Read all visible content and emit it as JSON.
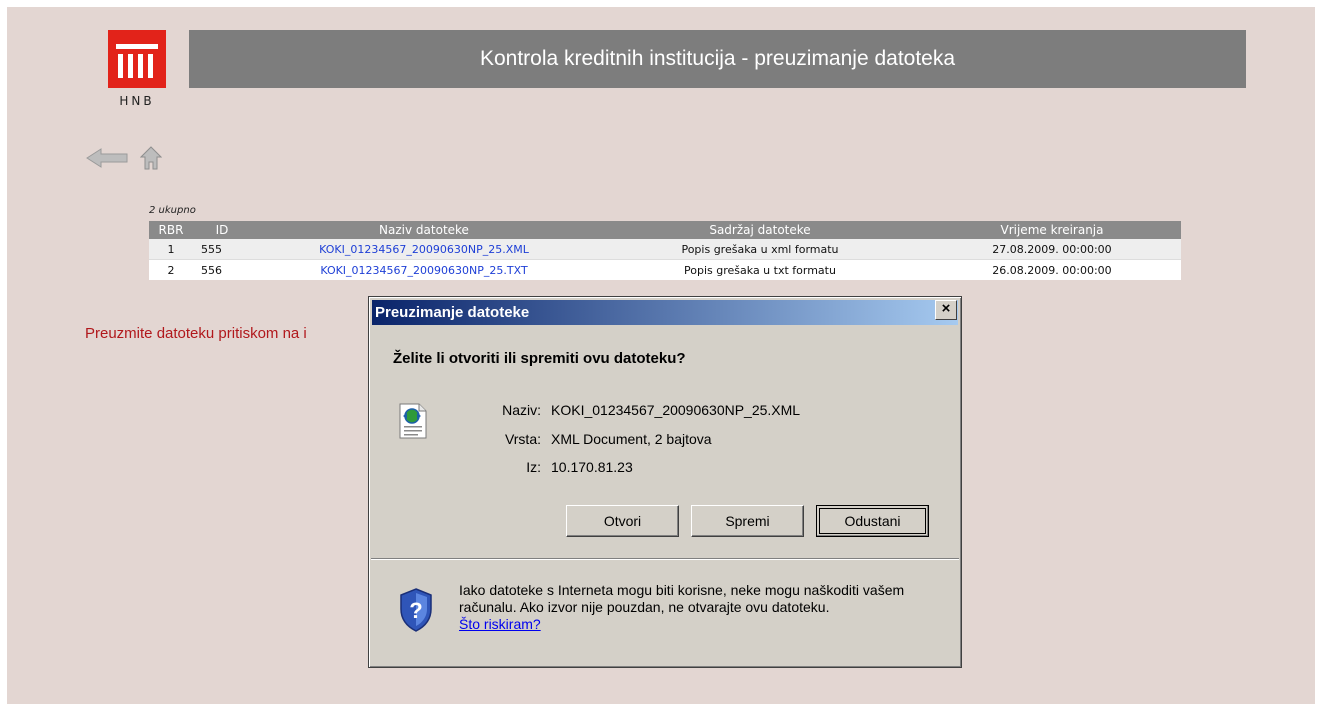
{
  "header": {
    "logo_text": "HNB",
    "title": "Kontrola kreditnih institucija - preuzimanje datoteka"
  },
  "nav": {
    "back_icon": "back-arrow-icon",
    "home_icon": "home-icon"
  },
  "table": {
    "total": "2 ukupno",
    "columns": [
      "RBR",
      "ID",
      "Naziv datoteke",
      "Sadržaj datoteke",
      "Vrijeme kreiranja"
    ],
    "rows": [
      {
        "rbr": "1",
        "id": "555",
        "name": "KOKI_01234567_20090630NP_25.XML",
        "content": "Popis grešaka u xml formatu",
        "created": "27.08.2009. 00:00:00"
      },
      {
        "rbr": "2",
        "id": "556",
        "name": "KOKI_01234567_20090630NP_25.TXT",
        "content": "Popis grešaka u txt formatu",
        "created": "26.08.2009. 00:00:00"
      }
    ]
  },
  "hint": "Preuzmite datoteku pritiskom na i",
  "dialog": {
    "title": "Preuzimanje datoteke",
    "close": "×",
    "question": "Želite li otvoriti ili spremiti ovu datoteku?",
    "name_label": "Naziv:",
    "name_value": "KOKI_01234567_20090630NP_25.XML",
    "type_label": "Vrsta:",
    "type_value": "XML Document, 2 bajtova",
    "from_label": "Iz:",
    "from_value": "10.170.81.23",
    "buttons": {
      "open": "Otvori",
      "save": "Spremi",
      "cancel": "Odustani"
    },
    "warning_text": "Iako datoteke s Interneta mogu biti korisne, neke mogu naškoditi vašem računalu. Ako izvor nije pouzdan, ne otvarajte ovu datoteku.",
    "warning_link": "Što riskiram?"
  },
  "colors": {
    "header_bar": "#7d7d7d",
    "logo_red": "#e2231a",
    "link": "#1e3fd6",
    "hint_red": "#b1181c",
    "titlebar_start": "#0a246a"
  }
}
